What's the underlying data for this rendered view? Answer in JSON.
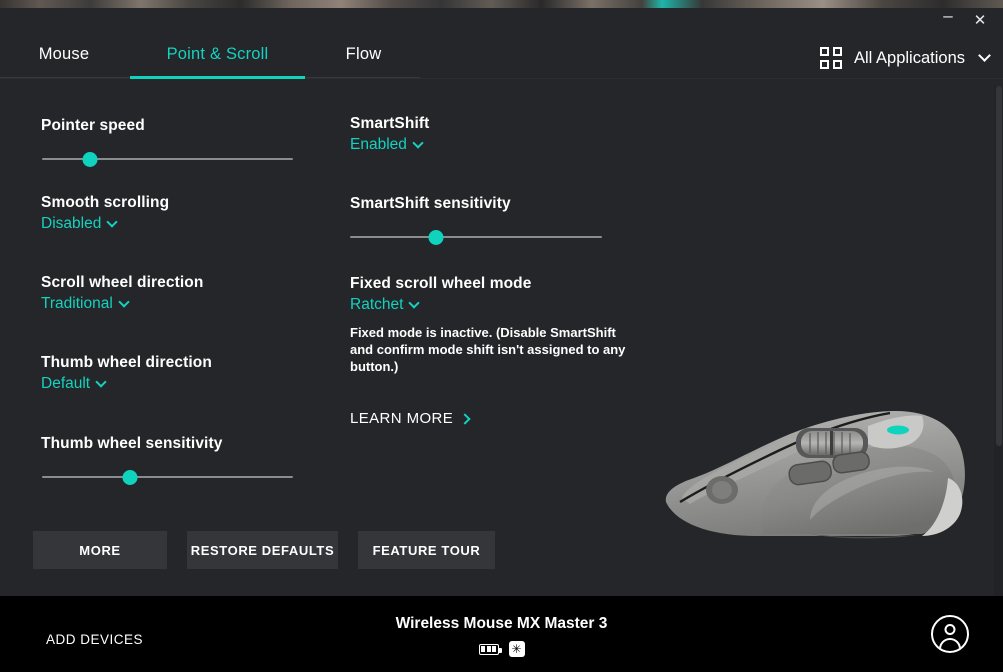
{
  "window": {
    "minimize_label": "–",
    "close_label": "✕"
  },
  "tabs": [
    {
      "label": "Mouse",
      "active": false
    },
    {
      "label": "Point & Scroll",
      "active": true
    },
    {
      "label": "Flow",
      "active": false
    }
  ],
  "app_selector": {
    "icon": "grid-apps-icon",
    "label": "All Applications",
    "chevron": "chevron-down-icon"
  },
  "settings": {
    "pointer_speed": {
      "label": "Pointer speed",
      "slider_percent": 19
    },
    "smooth_scrolling": {
      "label": "Smooth scrolling",
      "value": "Disabled"
    },
    "scroll_wheel_direction": {
      "label": "Scroll wheel direction",
      "value": "Traditional"
    },
    "thumb_wheel_direction": {
      "label": "Thumb wheel direction",
      "value": "Default"
    },
    "thumb_wheel_sensitivity": {
      "label": "Thumb wheel sensitivity",
      "slider_percent": 35
    },
    "smartshift": {
      "label": "SmartShift",
      "value": "Enabled"
    },
    "smartshift_sensitivity": {
      "label": "SmartShift sensitivity",
      "slider_percent": 34
    },
    "fixed_scroll_wheel_mode": {
      "label": "Fixed scroll wheel mode",
      "value": "Ratchet",
      "help_text": "Fixed mode is inactive. (Disable SmartShift and confirm mode shift isn't assigned to any button.)",
      "learn_more_label": "LEARN MORE"
    }
  },
  "buttons": {
    "more": "MORE",
    "restore_defaults": "RESTORE DEFAULTS",
    "feature_tour": "FEATURE TOUR"
  },
  "footer": {
    "add_devices": "ADD DEVICES",
    "device_name": "Wireless Mouse MX Master 3",
    "battery_icon": "battery-icon",
    "bluetooth_icon": "bluetooth-icon",
    "bluetooth_glyph": "✳",
    "account_icon": "account-avatar-icon"
  },
  "colors": {
    "accent": "#0fd3bd",
    "accent_text": "#14d2c0",
    "background": "#242629",
    "footer_background": "#000000",
    "button_background": "#34363a"
  }
}
